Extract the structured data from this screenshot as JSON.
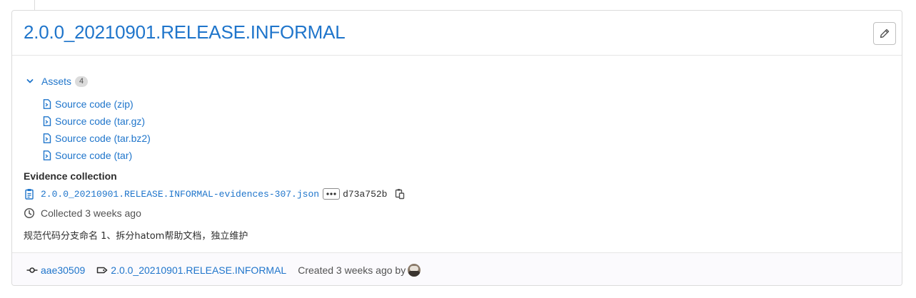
{
  "release": {
    "title": "2.0.0_20210901.RELEASE.INFORMAL",
    "edit_icon": "pencil-icon"
  },
  "assets": {
    "label": "Assets",
    "count": "4",
    "toggle_icon": "chevron-down-icon",
    "items": [
      {
        "label": "Source code (zip)",
        "icon": "doc-code-icon"
      },
      {
        "label": "Source code (tar.gz)",
        "icon": "doc-code-icon"
      },
      {
        "label": "Source code (tar.bz2)",
        "icon": "doc-code-icon"
      },
      {
        "label": "Source code (tar)",
        "icon": "doc-code-icon"
      }
    ]
  },
  "evidence": {
    "title": "Evidence collection",
    "file": "2.0.0_20210901.RELEASE.INFORMAL-evidences-307.json",
    "sha": "d73a752b",
    "collected": "Collected 3 weeks ago"
  },
  "description": "规范代码分支命名 1、拆分hatom帮助文档，独立维护",
  "footer": {
    "commit": "aae30509",
    "tag": "2.0.0_20210901.RELEASE.INFORMAL",
    "created": "Created 3 weeks ago by"
  },
  "colors": {
    "link": "#1f75cb",
    "text": "#2e2e2e",
    "muted": "#525252",
    "border": "#dbdbdb"
  }
}
